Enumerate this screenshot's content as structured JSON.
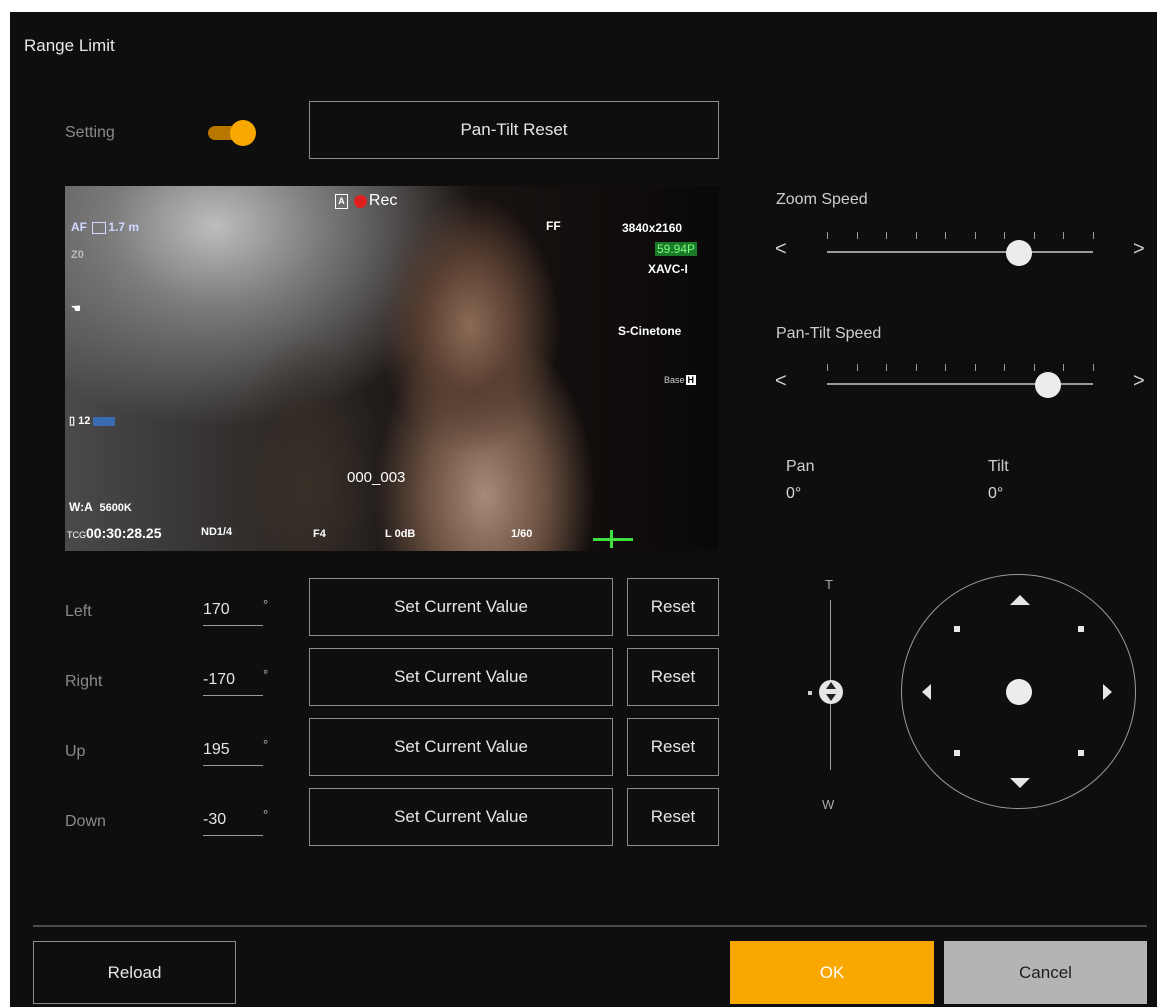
{
  "dialog": {
    "title": "Range Limit"
  },
  "setting": {
    "label": "Setting",
    "enabled": true,
    "toggle_color": "#f8a800"
  },
  "pan_tilt_reset_label": "Pan-Tilt Reset",
  "video_osd": {
    "focus_mode": "AF",
    "focus_distance": "1.7",
    "focus_unit": "m",
    "zoom_label": "Z0",
    "media_a": "A",
    "rec_label": "Rec",
    "sensor": "FF",
    "resolution": "3840x2160",
    "frame_rate": "59.94P",
    "codec": "XAVC-I",
    "look": "S-Cinetone",
    "base_iso": "Base",
    "base_iso_tag": "H",
    "media_remaining": "12",
    "clip_name": "000_003",
    "white_balance": "W:A",
    "wb_temp": "5600K",
    "timecode_label": "TCG",
    "timecode": "00:30:28.25",
    "nd": "ND1/4",
    "iris": "F4",
    "gain": "L 0dB",
    "shutter": "1/60"
  },
  "limits": [
    {
      "label": "Left",
      "value": "170",
      "unit": "°",
      "set_label": "Set Current Value",
      "reset_label": "Reset"
    },
    {
      "label": "Right",
      "value": "-170",
      "unit": "°",
      "set_label": "Set Current Value",
      "reset_label": "Reset"
    },
    {
      "label": "Up",
      "value": "195",
      "unit": "°",
      "set_label": "Set Current Value",
      "reset_label": "Reset"
    },
    {
      "label": "Down",
      "value": "-30",
      "unit": "°",
      "set_label": "Set Current Value",
      "reset_label": "Reset"
    }
  ],
  "zoom_speed": {
    "label": "Zoom Speed",
    "left_arrow": "<",
    "right_arrow": ">",
    "ticks": 10,
    "level": 0.72
  },
  "pan_tilt_speed": {
    "label": "Pan-Tilt Speed",
    "left_arrow": "<",
    "right_arrow": ">",
    "ticks": 10,
    "level": 0.83
  },
  "position": {
    "pan_label": "Pan",
    "pan_value": "0°",
    "tilt_label": "Tilt",
    "tilt_value": "0°"
  },
  "zoom_control": {
    "tele_label": "T",
    "wide_label": "W"
  },
  "footer": {
    "reload_label": "Reload",
    "ok_label": "OK",
    "cancel_label": "Cancel"
  },
  "colors": {
    "accent": "#f8a800",
    "cancel_bg": "#b4b4b4",
    "panel_bg": "#0e0e0e"
  }
}
